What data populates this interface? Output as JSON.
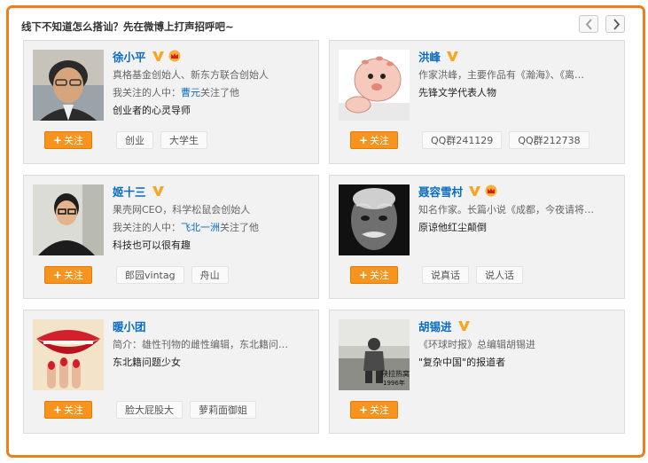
{
  "header": {
    "title": "线下不知道怎么搭讪？先在微博上打声招呼吧~",
    "prev_icon": "chevron-left-icon",
    "next_icon": "chevron-right-icon"
  },
  "colors": {
    "accent": "#ef7d1a",
    "follow_button": "#f7941d",
    "link": "#0a6cc0",
    "verified": "#f5a623"
  },
  "follow_label": "关注",
  "cards": [
    {
      "name": "徐小平",
      "verified": true,
      "crown": true,
      "desc": "真格基金创始人、新东方联合创始人",
      "relation_prefix": "我关注的人中：",
      "relation_link": "曹元",
      "relation_suffix": "关注了他",
      "tagline": "创业者的心灵导师",
      "tags": [
        "创业",
        "大学生"
      ]
    },
    {
      "name": "洪峰",
      "verified": true,
      "crown": false,
      "desc": "作家洪峰，主要作品有《瀚海》、《离…",
      "relation_prefix": "",
      "relation_link": "",
      "relation_suffix": "",
      "tagline": "先锋文学代表人物",
      "tags": [
        "QQ群241129",
        "QQ群212738"
      ]
    },
    {
      "name": "姬十三",
      "verified": true,
      "crown": false,
      "desc": "果壳网CEO，科学松鼠会创始人",
      "relation_prefix": "我关注的人中：",
      "relation_link": "飞北一洲",
      "relation_suffix": "关注了他",
      "tagline": "科技也可以很有趣",
      "tags": [
        "郎园vintag",
        "舟山"
      ]
    },
    {
      "name": "聂容雪村",
      "verified": true,
      "crown": true,
      "desc": "知名作家。长篇小说《成都，今夜请将…",
      "relation_prefix": "",
      "relation_link": "",
      "relation_suffix": "",
      "tagline": "原谅他红尘颠倒",
      "tags": [
        "说真话",
        "说人话"
      ]
    },
    {
      "name": "暖小团",
      "verified": false,
      "crown": false,
      "desc": "简介：雄性刊物的雌性编辑，东北籍问…",
      "relation_prefix": "",
      "relation_link": "",
      "relation_suffix": "",
      "tagline": "东北籍问题少女",
      "tags": [
        "脸大屁股大",
        "萝莉面御姐"
      ]
    },
    {
      "name": "胡锡进",
      "verified": true,
      "crown": false,
      "desc": "《环球时报》总编辑胡锡进",
      "relation_prefix": "",
      "relation_link": "",
      "relation_suffix": "",
      "tagline": "\"复杂中国\"的报道者",
      "tags": []
    }
  ],
  "avatar_texts": {
    "card6_photo_caption": "陕拉热窝",
    "card6_photo_year": "1996年"
  }
}
